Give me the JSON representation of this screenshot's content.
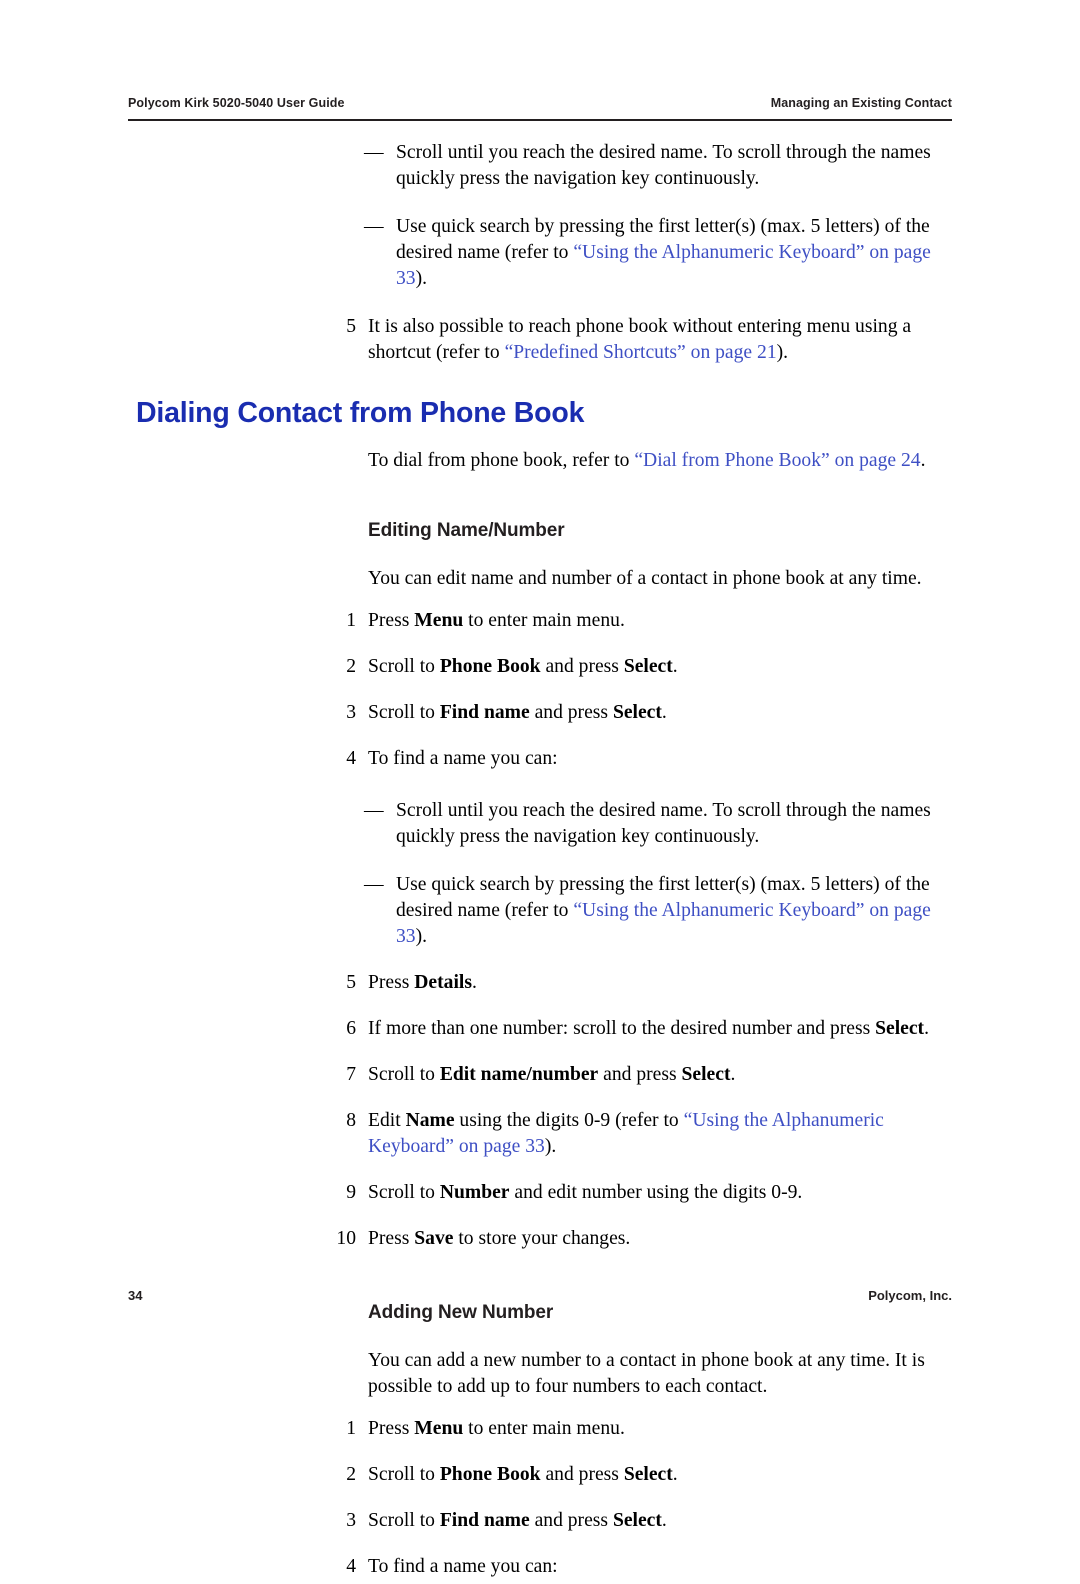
{
  "header": {
    "left": "Polycom Kirk 5020-5040 User Guide",
    "right": "Managing an Existing Contact"
  },
  "footer": {
    "page_number": "34",
    "company": "Polycom, Inc."
  },
  "colors": {
    "heading_blue": "#1a2db0",
    "link_blue": "#3e4fc4",
    "text": "#000000"
  },
  "body": {
    "block1": {
      "dash1": {
        "dash": "—",
        "text": "Scroll until you reach the desired name. To scroll through the names quickly press the navigation key continuously."
      },
      "dash2": {
        "dash": "—",
        "pre": "Use quick search by pressing the first letter(s) (max. 5 letters) of the desired name (refer to ",
        "link": "“Using the Alphanumeric Keyboard” on page 33",
        "post": ")."
      },
      "step5": {
        "num": "5",
        "pre": "It is also possible to reach phone book without entering menu using a shortcut (refer to ",
        "link": "“Predefined Shortcuts” on page 21",
        "post": ")."
      }
    },
    "section1": {
      "title": "Dialing Contact from Phone Book",
      "para_pre": "To dial from phone book, refer to ",
      "para_link": "“Dial from Phone Book” on page 24",
      "para_post": "."
    },
    "subsection1": {
      "title": "Editing Name/Number",
      "intro": "You can edit name and number of a contact in phone book at any time.",
      "steps": [
        {
          "num": "1",
          "parts": [
            {
              "t": "Press ",
              "b": false
            },
            {
              "t": "Menu",
              "b": true
            },
            {
              "t": " to enter main menu.",
              "b": false
            }
          ]
        },
        {
          "num": "2",
          "parts": [
            {
              "t": "Scroll to ",
              "b": false
            },
            {
              "t": "Phone Book",
              "b": true
            },
            {
              "t": " and press ",
              "b": false
            },
            {
              "t": "Select",
              "b": true
            },
            {
              "t": ".",
              "b": false
            }
          ]
        },
        {
          "num": "3",
          "parts": [
            {
              "t": "Scroll to ",
              "b": false
            },
            {
              "t": "Find name",
              "b": true
            },
            {
              "t": " and press ",
              "b": false
            },
            {
              "t": "Select",
              "b": true
            },
            {
              "t": ".",
              "b": false
            }
          ]
        },
        {
          "num": "4",
          "parts": [
            {
              "t": "To find a name you can:",
              "b": false
            }
          ]
        }
      ],
      "dash1": {
        "dash": "—",
        "text": "Scroll until you reach the desired name. To scroll through the names quickly press the navigation key continuously."
      },
      "dash2": {
        "dash": "—",
        "pre": "Use quick search by pressing the first letter(s) (max. 5 letters) of the desired name (refer to ",
        "link": "“Using the Alphanumeric Keyboard” on page 33",
        "post": ")."
      },
      "steps2": [
        {
          "num": "5",
          "parts": [
            {
              "t": "Press ",
              "b": false
            },
            {
              "t": "Details",
              "b": true
            },
            {
              "t": ".",
              "b": false
            }
          ]
        },
        {
          "num": "6",
          "parts": [
            {
              "t": "If more than one number: scroll to the desired number and press ",
              "b": false
            },
            {
              "t": "Select",
              "b": true
            },
            {
              "t": ".",
              "b": false
            }
          ]
        },
        {
          "num": "7",
          "parts": [
            {
              "t": "Scroll to ",
              "b": false
            },
            {
              "t": "Edit name/number",
              "b": true
            },
            {
              "t": " and press ",
              "b": false
            },
            {
              "t": "Select",
              "b": true
            },
            {
              "t": ".",
              "b": false
            }
          ]
        }
      ],
      "step8": {
        "num": "8",
        "pre_plain": "Edit ",
        "pre_bold": "Name",
        "mid": " using the digits 0-9 (refer to ",
        "link": "“Using the Alphanumeric Keyboard” on page 33",
        "post": ")."
      },
      "steps3": [
        {
          "num": "9",
          "parts": [
            {
              "t": "Scroll to ",
              "b": false
            },
            {
              "t": "Number",
              "b": true
            },
            {
              "t": " and edit number using the digits 0-9.",
              "b": false
            }
          ]
        },
        {
          "num": "10",
          "parts": [
            {
              "t": "Press ",
              "b": false
            },
            {
              "t": "Save",
              "b": true
            },
            {
              "t": " to store your changes.",
              "b": false
            }
          ]
        }
      ]
    },
    "subsection2": {
      "title": "Adding New Number",
      "intro": "You can add a new number to a contact in phone book at any time. It is possible to add up to four numbers to each contact.",
      "steps": [
        {
          "num": "1",
          "parts": [
            {
              "t": "Press ",
              "b": false
            },
            {
              "t": "Menu",
              "b": true
            },
            {
              "t": " to enter main menu.",
              "b": false
            }
          ]
        },
        {
          "num": "2",
          "parts": [
            {
              "t": "Scroll to ",
              "b": false
            },
            {
              "t": "Phone Book",
              "b": true
            },
            {
              "t": " and press ",
              "b": false
            },
            {
              "t": "Select",
              "b": true
            },
            {
              "t": ".",
              "b": false
            }
          ]
        },
        {
          "num": "3",
          "parts": [
            {
              "t": "Scroll to ",
              "b": false
            },
            {
              "t": "Find name",
              "b": true
            },
            {
              "t": " and press ",
              "b": false
            },
            {
              "t": "Select",
              "b": true
            },
            {
              "t": ".",
              "b": false
            }
          ]
        },
        {
          "num": "4",
          "parts": [
            {
              "t": "To find a name you can:",
              "b": false
            }
          ]
        }
      ]
    }
  }
}
